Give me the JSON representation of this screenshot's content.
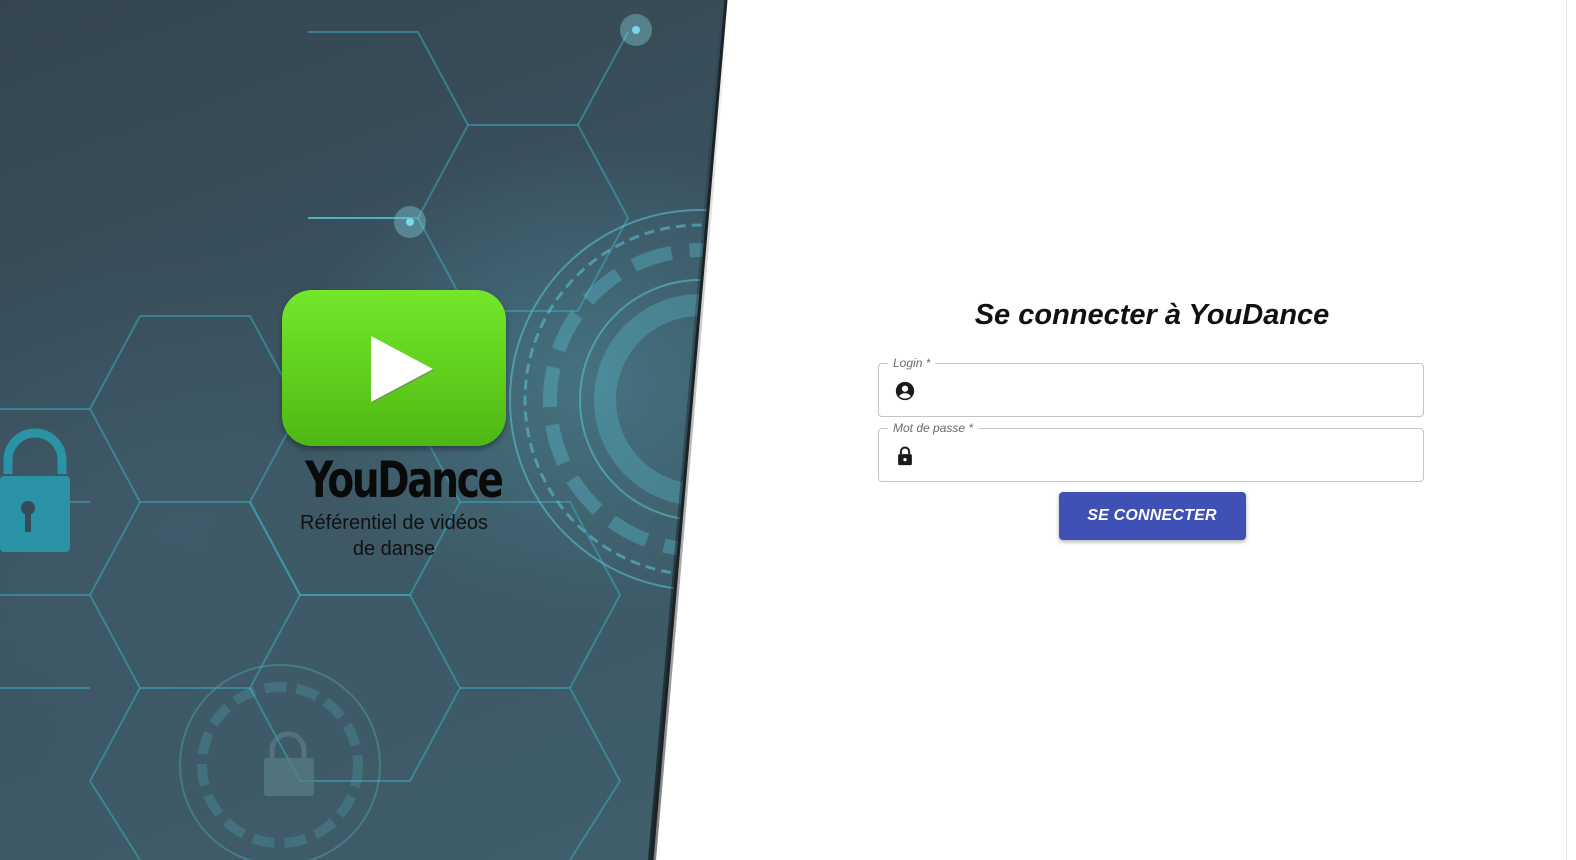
{
  "brand": {
    "name": "YouDance",
    "tagline_line1": "Référentiel de vidéos",
    "tagline_line2": "de danse",
    "logo_color": "#5fcf1c"
  },
  "login_form": {
    "title": "Se connecter à YouDance",
    "login_field": {
      "label": "Login *",
      "value": "",
      "icon": "account-circle-icon"
    },
    "password_field": {
      "label": "Mot de passe *",
      "value": "",
      "icon": "lock-icon"
    },
    "submit_label": "SE CONNECTER",
    "accent_color": "#3f51b5"
  }
}
